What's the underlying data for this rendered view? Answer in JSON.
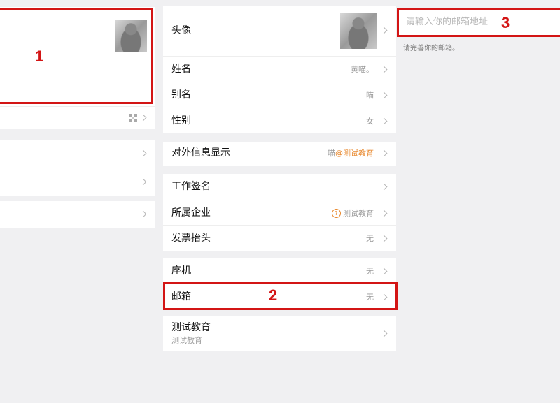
{
  "left": {
    "rows": [
      "",
      "",
      ""
    ]
  },
  "middle": {
    "avatar_label": "头像",
    "name_label": "姓名",
    "name_value": "黄喵。",
    "alias_label": "别名",
    "alias_value": "喵",
    "gender_label": "性别",
    "gender_value": "女",
    "external_label": "对外信息显示",
    "external_value_name": "喵",
    "external_value_at": "@",
    "external_value_org": "测试教育",
    "signature_label": "工作签名",
    "company_label": "所属企业",
    "company_value": "测试教育",
    "invoice_label": "发票抬头",
    "invoice_value": "无",
    "landline_label": "座机",
    "landline_value": "无",
    "email_label": "邮箱",
    "email_value": "无",
    "org_label": "测试教育",
    "org_sub": "测试教育"
  },
  "right": {
    "email_placeholder": "请输入你的邮箱地址",
    "email_hint": "请完善你的邮箱。"
  },
  "annotations": [
    "1",
    "2",
    "3"
  ],
  "colors": {
    "background": "#f0f0f2",
    "annotation_red": "#d31515",
    "accent_orange": "#e8882d",
    "muted_text": "#9a9a9a"
  }
}
